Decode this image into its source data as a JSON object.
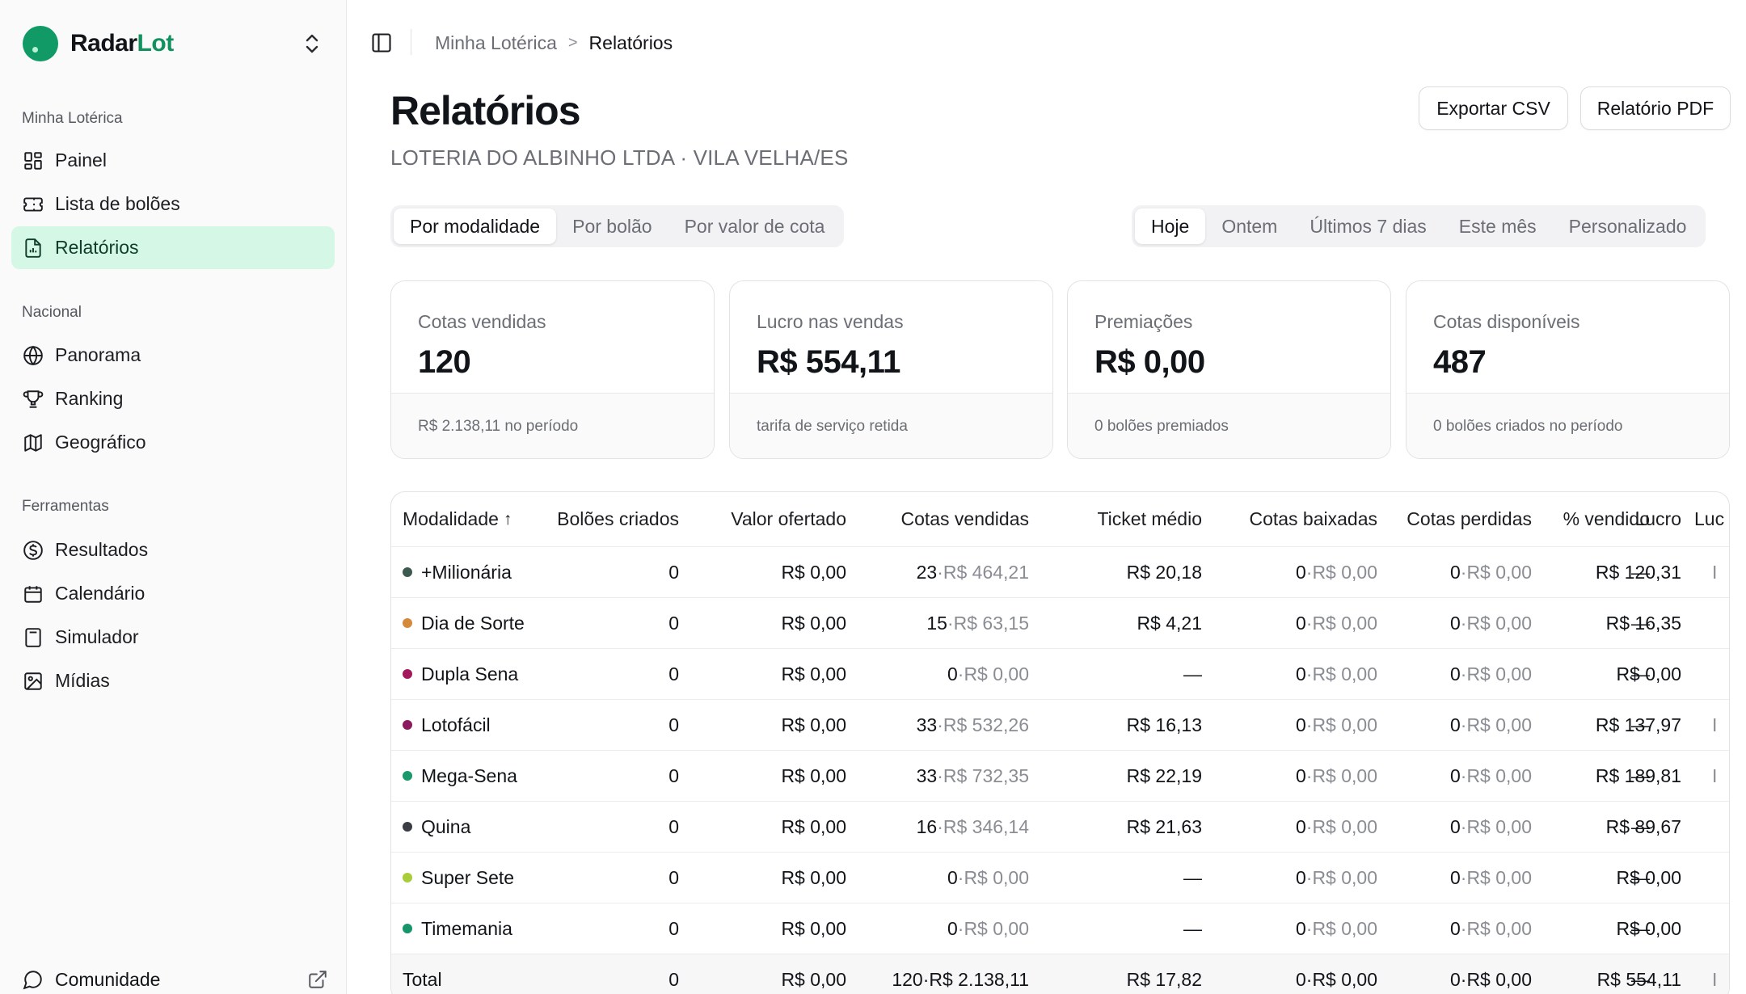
{
  "brand": {
    "name_part1": "Radar",
    "name_part2": "Lot"
  },
  "sidebar": {
    "sections": [
      {
        "title": "Minha Lotérica"
      },
      {
        "title": "Nacional"
      },
      {
        "title": "Ferramentas"
      }
    ],
    "items": [
      {
        "label": "Painel",
        "icon": "grid-icon"
      },
      {
        "label": "Lista de bolões",
        "icon": "ticket-icon"
      },
      {
        "label": "Relatórios",
        "icon": "report-icon",
        "active": true
      },
      {
        "label": "Panorama",
        "icon": "globe-icon"
      },
      {
        "label": "Ranking",
        "icon": "trophy-icon"
      },
      {
        "label": "Geográfico",
        "icon": "map-icon"
      },
      {
        "label": "Resultados",
        "icon": "dollar-circle-icon"
      },
      {
        "label": "Calendário",
        "icon": "calendar-icon"
      },
      {
        "label": "Simulador",
        "icon": "calculator-icon"
      },
      {
        "label": "Mídias",
        "icon": "image-icon"
      }
    ],
    "community": "Comunidade"
  },
  "breadcrumb": {
    "parent": "Minha Lotérica",
    "separator": ">",
    "current": "Relatórios"
  },
  "page": {
    "title": "Relatórios",
    "subtitle": "LOTERIA DO ALBINHO LTDA · VILA VELHA/ES"
  },
  "actions": {
    "csv": "Exportar CSV",
    "pdf": "Relatório PDF"
  },
  "view_tabs": [
    "Por modalidade",
    "Por bolão",
    "Por valor de cota"
  ],
  "period_tabs": [
    "Hoje",
    "Ontem",
    "Últimos 7 dias",
    "Este mês",
    "Personalizado"
  ],
  "kpis": [
    {
      "label": "Cotas vendidas",
      "value": "120",
      "foot": "R$ 2.138,11 no período"
    },
    {
      "label": "Lucro nas vendas",
      "value": "R$ 554,11",
      "foot": "tarifa de serviço retida"
    },
    {
      "label": "Premiações",
      "value": "R$ 0,00",
      "foot": "0 bolões premiados"
    },
    {
      "label": "Cotas disponíveis",
      "value": "487",
      "foot": "0 bolões criados no período"
    }
  ],
  "table": {
    "headers": [
      "Modalidade",
      "Bolões criados",
      "Valor ofertado",
      "Cotas vendidas",
      "Ticket médio",
      "Cotas baixadas",
      "Cotas perdidas",
      "% vendido",
      "Lucro",
      "Luc"
    ],
    "sort_arrow": "↑",
    "rows": [
      {
        "name": "+Milionária",
        "color": "#3c5a4f",
        "boloes": "0",
        "ofertado": "R$ 0,00",
        "vend_n": "23",
        "vend_v": "R$ 464,21",
        "ticket": "R$ 20,18",
        "baix_n": "0",
        "baix_v": "R$ 0,00",
        "perd_n": "0",
        "perd_v": "R$ 0,00",
        "pct": "—",
        "lucro": "R$ 120,31",
        "extra": "I"
      },
      {
        "name": "Dia de Sorte",
        "color": "#d4893b",
        "boloes": "0",
        "ofertado": "R$ 0,00",
        "vend_n": "15",
        "vend_v": "R$ 63,15",
        "ticket": "R$ 4,21",
        "baix_n": "0",
        "baix_v": "R$ 0,00",
        "perd_n": "0",
        "perd_v": "R$ 0,00",
        "pct": "—",
        "lucro": "R$ 16,35",
        "extra": ""
      },
      {
        "name": "Dupla Sena",
        "color": "#a3195b",
        "boloes": "0",
        "ofertado": "R$ 0,00",
        "vend_n": "0",
        "vend_v": "R$ 0,00",
        "ticket": "—",
        "baix_n": "0",
        "baix_v": "R$ 0,00",
        "perd_n": "0",
        "perd_v": "R$ 0,00",
        "pct": "—",
        "lucro": "R$ 0,00",
        "extra": ""
      },
      {
        "name": "Lotofácil",
        "color": "#8b1a5e",
        "boloes": "0",
        "ofertado": "R$ 0,00",
        "vend_n": "33",
        "vend_v": "R$ 532,26",
        "ticket": "R$ 16,13",
        "baix_n": "0",
        "baix_v": "R$ 0,00",
        "perd_n": "0",
        "perd_v": "R$ 0,00",
        "pct": "—",
        "lucro": "R$ 137,97",
        "extra": "I"
      },
      {
        "name": "Mega-Sena",
        "color": "#1a9a6a",
        "boloes": "0",
        "ofertado": "R$ 0,00",
        "vend_n": "33",
        "vend_v": "R$ 732,35",
        "ticket": "R$ 22,19",
        "baix_n": "0",
        "baix_v": "R$ 0,00",
        "perd_n": "0",
        "perd_v": "R$ 0,00",
        "pct": "—",
        "lucro": "R$ 189,81",
        "extra": "I"
      },
      {
        "name": "Quina",
        "color": "#3a3d44",
        "boloes": "0",
        "ofertado": "R$ 0,00",
        "vend_n": "16",
        "vend_v": "R$ 346,14",
        "ticket": "R$ 21,63",
        "baix_n": "0",
        "baix_v": "R$ 0,00",
        "perd_n": "0",
        "perd_v": "R$ 0,00",
        "pct": "—",
        "lucro": "R$ 89,67",
        "extra": ""
      },
      {
        "name": "Super Sete",
        "color": "#a8cc3a",
        "boloes": "0",
        "ofertado": "R$ 0,00",
        "vend_n": "0",
        "vend_v": "R$ 0,00",
        "ticket": "—",
        "baix_n": "0",
        "baix_v": "R$ 0,00",
        "perd_n": "0",
        "perd_v": "R$ 0,00",
        "pct": "—",
        "lucro": "R$ 0,00",
        "extra": ""
      },
      {
        "name": "Timemania",
        "color": "#17956a",
        "boloes": "0",
        "ofertado": "R$ 0,00",
        "vend_n": "0",
        "vend_v": "R$ 0,00",
        "ticket": "—",
        "baix_n": "0",
        "baix_v": "R$ 0,00",
        "perd_n": "0",
        "perd_v": "R$ 0,00",
        "pct": "—",
        "lucro": "R$ 0,00",
        "extra": ""
      }
    ],
    "total": {
      "name": "Total",
      "boloes": "0",
      "ofertado": "R$ 0,00",
      "vend_n": "120",
      "vend_v": "R$ 2.138,11",
      "ticket": "R$ 17,82",
      "baix_n": "0",
      "baix_v": "R$ 0,00",
      "perd_n": "0",
      "perd_v": "R$ 0,00",
      "pct": "—",
      "lucro": "R$ 554,11",
      "extra": "I"
    },
    "value_separator": "·"
  }
}
